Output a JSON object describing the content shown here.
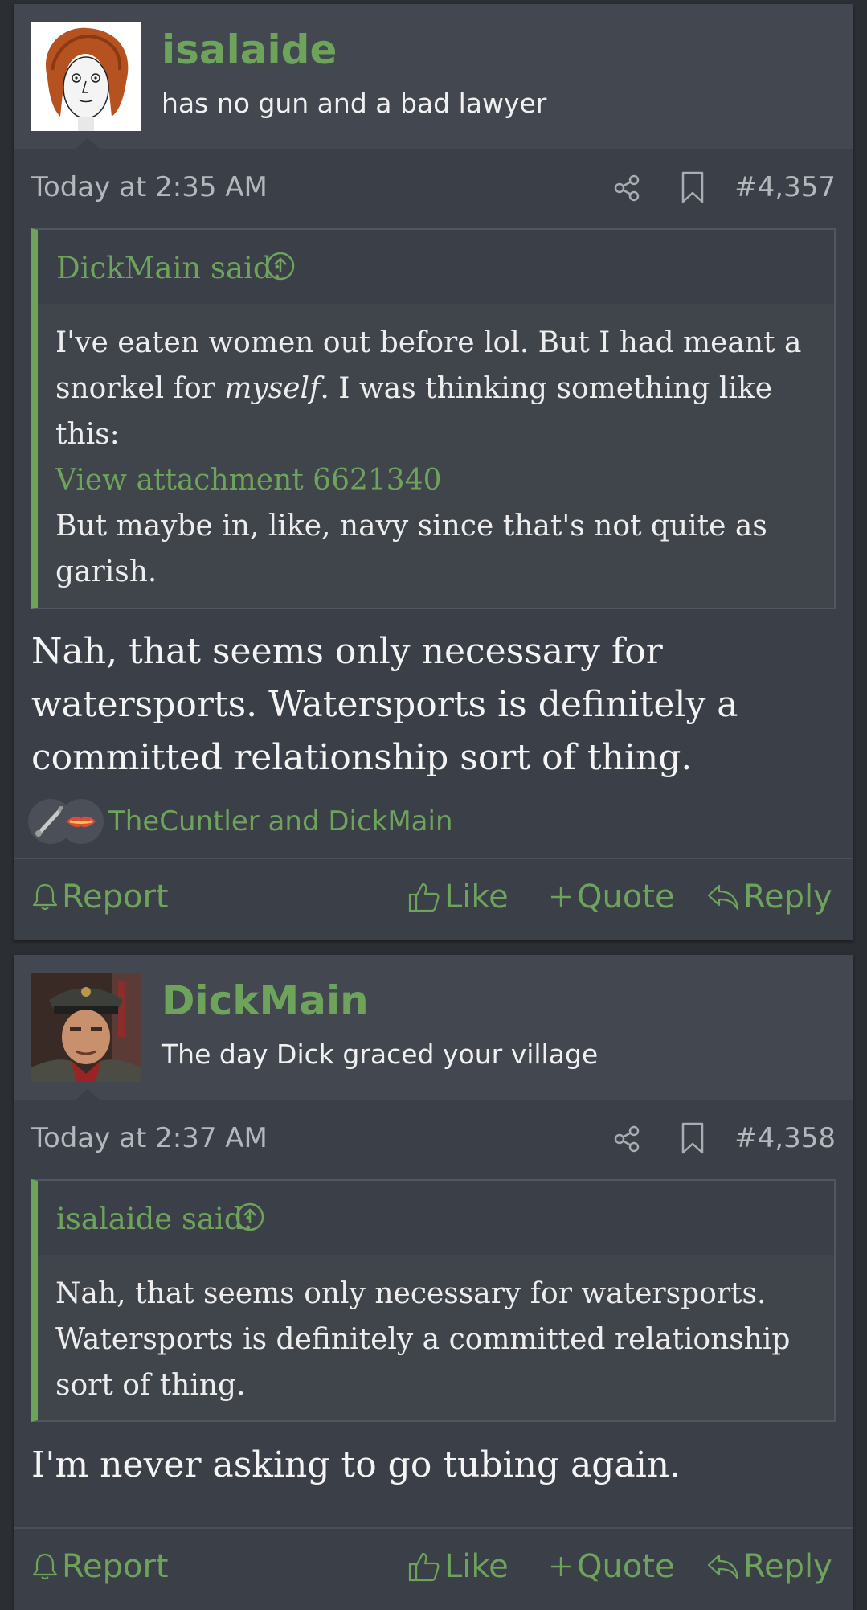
{
  "colors": {
    "accent": "#6ea35b",
    "card": "#3b3f47",
    "header": "#43474f",
    "page": "#2b2e33"
  },
  "posts": [
    {
      "author": "isalaide",
      "user_title": "has no gun and a bad lawyer",
      "date": "Today at 2:35 AM",
      "post_number": "#4,357",
      "quote": {
        "author_label": "DickMain said:",
        "body_before": "I've eaten women out before lol. But I had meant a snorkel for ",
        "body_italic": "myself",
        "body_after": ". I was thinking something like this:",
        "attachment_link": "View attachment 6621340",
        "body_end": "But maybe in, like, navy since that's not quite as garish."
      },
      "message": "Nah, that seems only necessary for watersports. Watersports is definitely a committed relationship sort of thing.",
      "reactions": {
        "names": "TheCuntler and DickMain",
        "icons": [
          "pipe-reaction-icon",
          "lips-reaction-icon"
        ]
      },
      "actions": {
        "report": "Report",
        "like": "Like",
        "quote": "Quote",
        "reply": "Reply"
      }
    },
    {
      "author": "DickMain",
      "user_title": "The day Dick graced your village",
      "date": "Today at 2:37 AM",
      "post_number": "#4,358",
      "quote": {
        "author_label": "isalaide said:",
        "body": "Nah, that seems only necessary for watersports. Watersports is definitely a committed relationship sort of thing."
      },
      "message": "I'm never asking to go tubing again.",
      "actions": {
        "report": "Report",
        "like": "Like",
        "quote": "Quote",
        "reply": "Reply"
      }
    }
  ]
}
